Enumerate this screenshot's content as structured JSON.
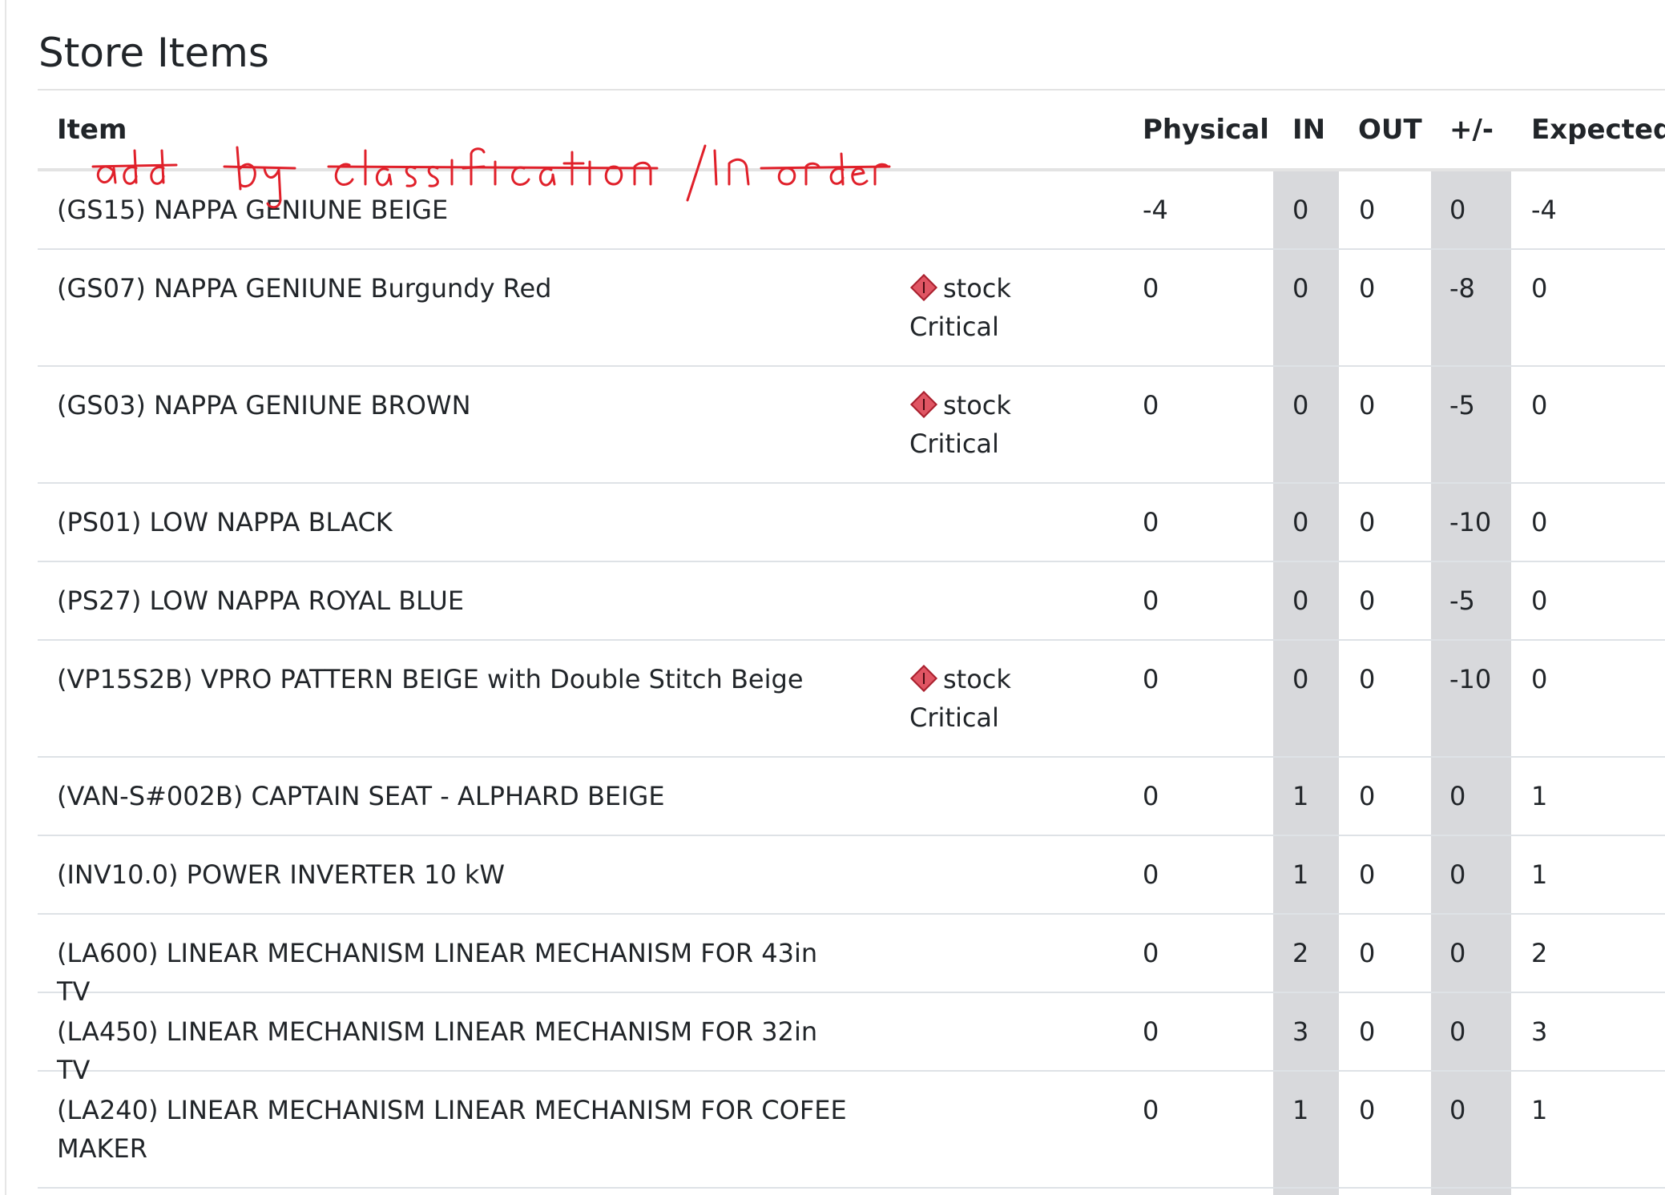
{
  "panel": {
    "title": "Store Items"
  },
  "table": {
    "headers": {
      "item": "Item",
      "physical": "Physical",
      "in": "IN",
      "out": "OUT",
      "diff": "+/-",
      "expected": "Expected"
    },
    "rows": [
      {
        "item": "(GS15) NAPPA GENIUNE BEIGE",
        "status": "",
        "physical": "-4",
        "in": "0",
        "out": "0",
        "diff": "0",
        "expected": "-4"
      },
      {
        "item": "(GS07) NAPPA GENIUNE Burgundy Red",
        "status": "stock Critical",
        "physical": "0",
        "in": "0",
        "out": "0",
        "diff": "-8",
        "expected": "0"
      },
      {
        "item": "(GS03) NAPPA GENIUNE BROWN",
        "status": "stock Critical",
        "physical": "0",
        "in": "0",
        "out": "0",
        "diff": "-5",
        "expected": "0"
      },
      {
        "item": "(PS01) LOW NAPPA BLACK",
        "status": "",
        "physical": "0",
        "in": "0",
        "out": "0",
        "diff": "-10",
        "expected": "0"
      },
      {
        "item": "(PS27) LOW NAPPA ROYAL BLUE",
        "status": "",
        "physical": "0",
        "in": "0",
        "out": "0",
        "diff": "-5",
        "expected": "0"
      },
      {
        "item": "(VP15S2B) VPRO PATTERN BEIGE with Double Stitch Beige",
        "status": "stock Critical",
        "physical": "0",
        "in": "0",
        "out": "0",
        "diff": "-10",
        "expected": "0"
      },
      {
        "item": "(VAN-S#002B) CAPTAIN SEAT - ALPHARD BEIGE",
        "status": "",
        "physical": "0",
        "in": "1",
        "out": "0",
        "diff": "0",
        "expected": "1"
      },
      {
        "item": "(INV10.0) POWER INVERTER 10 kW",
        "status": "",
        "physical": "0",
        "in": "1",
        "out": "0",
        "diff": "0",
        "expected": "1"
      },
      {
        "item": "(LA600) LINEAR MECHANISM LINEAR MECHANISM FOR 43in TV",
        "status": "",
        "physical": "0",
        "in": "2",
        "out": "0",
        "diff": "0",
        "expected": "2"
      },
      {
        "item": "(LA450) LINEAR MECHANISM LINEAR MECHANISM FOR 32in TV",
        "status": "",
        "physical": "0",
        "in": "3",
        "out": "0",
        "diff": "0",
        "expected": "3"
      },
      {
        "item": "(LA240) LINEAR MECHANISM LINEAR MECHANISM FOR COFEE MAKER",
        "status": "",
        "physical": "0",
        "in": "1",
        "out": "0",
        "diff": "0",
        "expected": "1"
      }
    ]
  },
  "annotation": {
    "text": "add by classification /in order",
    "color": "#e0202a",
    "icon": "handwritten-note"
  },
  "colors": {
    "shaded_column": "#d8d9dc",
    "critical_icon": "#e05563"
  }
}
